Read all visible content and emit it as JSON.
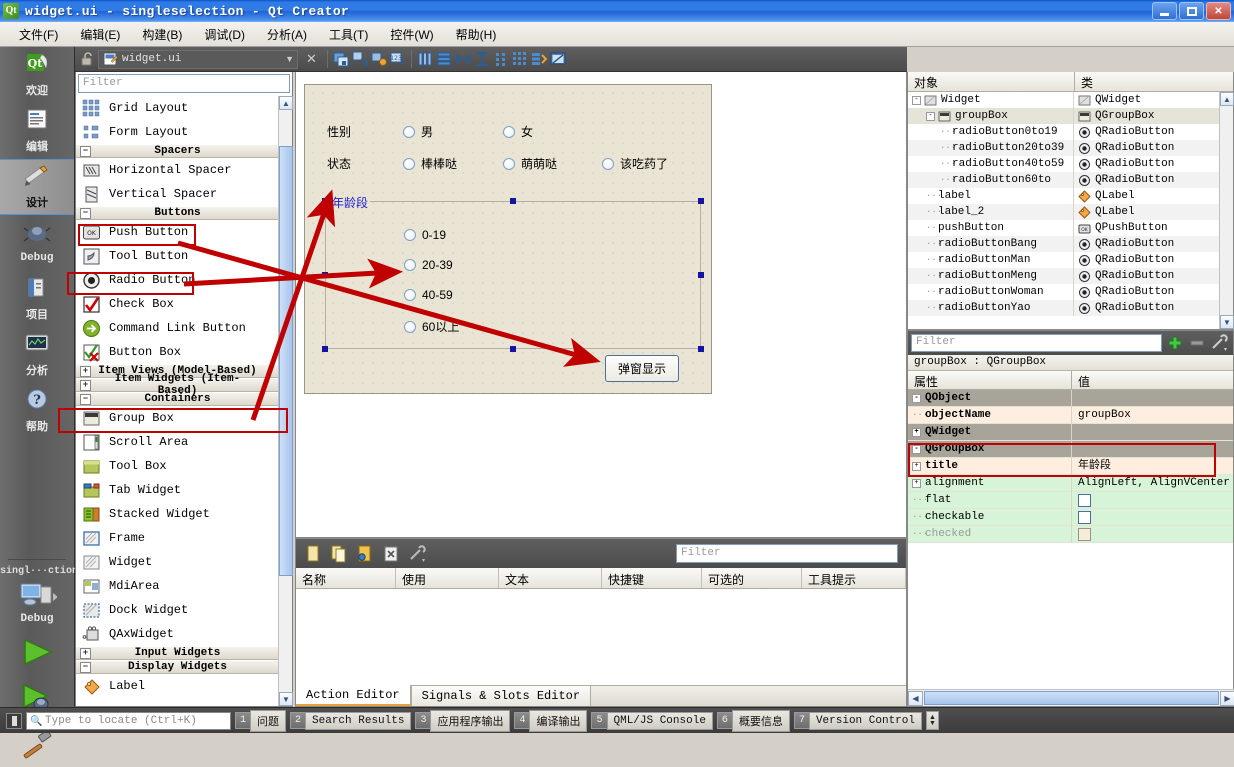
{
  "window": {
    "title": "widget.ui - singleselection - Qt Creator",
    "app_icon": "qt-logo-icon",
    "buttons": {
      "minimize": "minimize-icon",
      "maximize": "maximize-icon",
      "close": "close-icon"
    }
  },
  "menubar": {
    "items": [
      {
        "label": "文件(F)"
      },
      {
        "label": "编辑(E)"
      },
      {
        "label": "构建(B)"
      },
      {
        "label": "调试(D)"
      },
      {
        "label": "分析(A)"
      },
      {
        "label": "工具(T)"
      },
      {
        "label": "控件(W)"
      },
      {
        "label": "帮助(H)"
      }
    ]
  },
  "modebar": {
    "modes": [
      {
        "label": "欢迎",
        "icon": "qt-welcome-icon",
        "active": false
      },
      {
        "label": "编辑",
        "icon": "edit-document-icon",
        "active": false
      },
      {
        "label": "设计",
        "icon": "design-pencil-ruler-icon",
        "active": true
      },
      {
        "label": "Debug",
        "icon": "debug-bug-icon",
        "active": false
      },
      {
        "label": "项目",
        "icon": "projects-book-icon",
        "active": false
      },
      {
        "label": "分析",
        "icon": "analyze-monitor-icon",
        "active": false
      },
      {
        "label": "帮助",
        "icon": "help-question-icon",
        "active": false
      }
    ],
    "kit_name": "singl···ction",
    "kit_config": "Debug",
    "run_button": "run-play-icon",
    "debug_button": "run-debug-icon",
    "build_button": "build-hammer-icon"
  },
  "editor_toolbar": {
    "lock_icon": "unlock-icon",
    "file_icon": "ui-file-icon",
    "filename": "widget.ui",
    "dropdown_icon": "chevron-down-icon",
    "close_icon": "close-x-icon",
    "tools": [
      "adjust-size-icon",
      "break-layout-icon",
      "signal-slot-editor-icon",
      "buddy-editor-icon",
      "layout-vertical-icon",
      "layout-horizontal-icon",
      "layout-splitter-h-icon",
      "layout-splitter-v-icon",
      "layout-form-icon",
      "layout-grid-icon",
      "layout-morph-icon",
      "preview-icon"
    ]
  },
  "widget_box": {
    "filter_placeholder": "Filter",
    "sections": [
      {
        "type": "item",
        "label": "Grid Layout",
        "icon": "grid-layout-icon"
      },
      {
        "type": "item",
        "label": "Form Layout",
        "icon": "form-layout-icon"
      },
      {
        "type": "category",
        "label": "Spacers",
        "expanded": true
      },
      {
        "type": "item",
        "label": "Horizontal Spacer",
        "icon": "horizontal-spacer-icon"
      },
      {
        "type": "item",
        "label": "Vertical Spacer",
        "icon": "vertical-spacer-icon"
      },
      {
        "type": "category",
        "label": "Buttons",
        "expanded": true
      },
      {
        "type": "item",
        "label": "Push Button",
        "icon": "push-button-icon",
        "highlighted": true
      },
      {
        "type": "item",
        "label": "Tool Button",
        "icon": "tool-button-icon"
      },
      {
        "type": "item",
        "label": "Radio Button",
        "icon": "radio-button-icon",
        "highlighted": true
      },
      {
        "type": "item",
        "label": "Check Box",
        "icon": "check-box-icon"
      },
      {
        "type": "item",
        "label": "Command Link Button",
        "icon": "command-link-button-icon"
      },
      {
        "type": "item",
        "label": "Button Box",
        "icon": "button-box-icon"
      },
      {
        "type": "category",
        "label": "Item Views (Model-Based)",
        "expanded": false
      },
      {
        "type": "category",
        "label": "Item Widgets (Item-Based)",
        "expanded": false
      },
      {
        "type": "category",
        "label": "Containers",
        "expanded": true
      },
      {
        "type": "item",
        "label": "Group Box",
        "icon": "group-box-icon",
        "highlighted": true
      },
      {
        "type": "item",
        "label": "Scroll Area",
        "icon": "scroll-area-icon"
      },
      {
        "type": "item",
        "label": "Tool Box",
        "icon": "tool-box-icon"
      },
      {
        "type": "item",
        "label": "Tab Widget",
        "icon": "tab-widget-icon"
      },
      {
        "type": "item",
        "label": "Stacked Widget",
        "icon": "stacked-widget-icon"
      },
      {
        "type": "item",
        "label": "Frame",
        "icon": "frame-icon"
      },
      {
        "type": "item",
        "label": "Widget",
        "icon": "widget-icon"
      },
      {
        "type": "item",
        "label": "MdiArea",
        "icon": "mdi-area-icon"
      },
      {
        "type": "item",
        "label": "Dock Widget",
        "icon": "dock-widget-icon"
      },
      {
        "type": "item",
        "label": "QAxWidget",
        "icon": "qax-widget-icon"
      },
      {
        "type": "category",
        "label": "Input Widgets",
        "expanded": false
      },
      {
        "type": "category",
        "label": "Display Widgets",
        "expanded": true
      },
      {
        "type": "item",
        "label": "Label",
        "icon": "label-icon"
      }
    ]
  },
  "form": {
    "labels": [
      {
        "name": "label",
        "text": "性别"
      },
      {
        "name": "label_2",
        "text": "状态"
      }
    ],
    "radios_gender": [
      {
        "name": "radioButtonMan",
        "text": "男"
      },
      {
        "name": "radioButtonWoman",
        "text": "女"
      }
    ],
    "radios_status": [
      {
        "name": "radioButtonBang",
        "text": "棒棒哒"
      },
      {
        "name": "radioButtonMeng",
        "text": "萌萌哒"
      },
      {
        "name": "radioButtonYao",
        "text": "该吃药了"
      }
    ],
    "group_box": {
      "name": "groupBox",
      "title": "年龄段",
      "radios": [
        {
          "name": "radioButton0to19",
          "text": "0-19"
        },
        {
          "name": "radioButton20to39",
          "text": "20-39"
        },
        {
          "name": "radioButton40to59",
          "text": "40-59"
        },
        {
          "name": "radioButton60to",
          "text": "60以上"
        }
      ]
    },
    "push_button": {
      "name": "pushButton",
      "text": "弹窗显示"
    }
  },
  "object_inspector": {
    "columns": [
      "对象",
      "类"
    ],
    "rows": [
      {
        "name": "Widget",
        "class": "QWidget",
        "indent": 0,
        "expander": "-",
        "icon": "widget-tree-icon",
        "selected": false
      },
      {
        "name": "groupBox",
        "class": "QGroupBox",
        "indent": 1,
        "expander": "-",
        "icon": "groupbox-tree-icon",
        "selected": true
      },
      {
        "name": "radioButton0to19",
        "class": "QRadioButton",
        "indent": 2,
        "expander": "",
        "icon": "radio-tree-icon",
        "selected": false
      },
      {
        "name": "radioButton20to39",
        "class": "QRadioButton",
        "indent": 2,
        "expander": "",
        "icon": "radio-tree-icon",
        "selected": false
      },
      {
        "name": "radioButton40to59",
        "class": "QRadioButton",
        "indent": 2,
        "expander": "",
        "icon": "radio-tree-icon",
        "selected": false
      },
      {
        "name": "radioButton60to",
        "class": "QRadioButton",
        "indent": 2,
        "expander": "",
        "icon": "radio-tree-icon",
        "selected": false
      },
      {
        "name": "label",
        "class": "QLabel",
        "indent": 1,
        "expander": "",
        "icon": "label-tree-icon",
        "selected": false
      },
      {
        "name": "label_2",
        "class": "QLabel",
        "indent": 1,
        "expander": "",
        "icon": "label-tree-icon",
        "selected": false
      },
      {
        "name": "pushButton",
        "class": "QPushButton",
        "indent": 1,
        "expander": "",
        "icon": "pushbutton-tree-icon",
        "selected": false
      },
      {
        "name": "radioButtonBang",
        "class": "QRadioButton",
        "indent": 1,
        "expander": "",
        "icon": "radio-tree-icon",
        "selected": false
      },
      {
        "name": "radioButtonMan",
        "class": "QRadioButton",
        "indent": 1,
        "expander": "",
        "icon": "radio-tree-icon",
        "selected": false
      },
      {
        "name": "radioButtonMeng",
        "class": "QRadioButton",
        "indent": 1,
        "expander": "",
        "icon": "radio-tree-icon",
        "selected": false
      },
      {
        "name": "radioButtonWoman",
        "class": "QRadioButton",
        "indent": 1,
        "expander": "",
        "icon": "radio-tree-icon",
        "selected": false
      },
      {
        "name": "radioButtonYao",
        "class": "QRadioButton",
        "indent": 1,
        "expander": "",
        "icon": "radio-tree-icon",
        "selected": false
      }
    ]
  },
  "property_editor": {
    "filter_placeholder": "Filter",
    "add_icon": "plus-icon",
    "remove_icon": "minus-icon",
    "config_icon": "wrench-icon",
    "object_line": "groupBox : QGroupBox",
    "columns": [
      "属性",
      "值"
    ],
    "rows": [
      {
        "key": "QObject",
        "value": "",
        "kind": "group",
        "expander": "-"
      },
      {
        "key": "objectName",
        "value": "groupBox",
        "kind": "sub",
        "expander": ""
      },
      {
        "key": "QWidget",
        "value": "",
        "kind": "group",
        "expander": "+"
      },
      {
        "key": "QGroupBox",
        "value": "",
        "kind": "group",
        "expander": "-",
        "highlighted": true
      },
      {
        "key": "title",
        "value": "年龄段",
        "kind": "sub",
        "expander": "+",
        "highlighted": true
      },
      {
        "key": "alignment",
        "value": "AlignLeft, AlignVCenter",
        "kind": "green",
        "expander": "+"
      },
      {
        "key": "flat",
        "value": "",
        "kind": "green",
        "expander": "",
        "checkbox": "unchecked"
      },
      {
        "key": "checkable",
        "value": "",
        "kind": "green",
        "expander": "",
        "checkbox": "unchecked"
      },
      {
        "key": "checked",
        "value": "",
        "kind": "green",
        "expander": "",
        "checkbox": "disabled",
        "disabled": true
      }
    ],
    "hscroll": {
      "left_icon": "chevron-left-icon",
      "right_icon": "chevron-right-icon"
    }
  },
  "action_editor": {
    "toolbar_icons": [
      "new-action-icon",
      "copy-action-icon",
      "edit-action-icon",
      "delete-action-icon",
      "configure-icon"
    ],
    "filter_placeholder": "Filter",
    "columns": [
      "名称",
      "使用",
      "文本",
      "快捷键",
      "可选的",
      "工具提示"
    ],
    "rows": [],
    "tabs": [
      {
        "label": "Action Editor",
        "active": true
      },
      {
        "label": "Signals & Slots Editor",
        "active": false
      }
    ]
  },
  "statusbar": {
    "locate_placeholder": "Type to locate (Ctrl+K)",
    "search_icon": "magnifier-icon",
    "panel_toggle_icon": "panel-toggle-icon",
    "items": [
      {
        "num": "1",
        "label": "问题"
      },
      {
        "num": "2",
        "label": "Search Results"
      },
      {
        "num": "3",
        "label": "应用程序输出"
      },
      {
        "num": "4",
        "label": "编译输出"
      },
      {
        "num": "5",
        "label": "QML/JS Console"
      },
      {
        "num": "6",
        "label": "概要信息"
      },
      {
        "num": "7",
        "label": "Version Control"
      }
    ],
    "updown_icon": "up-down-arrows-icon"
  },
  "annotations": {
    "color": "#c00000",
    "arrows": [
      {
        "from": "Push Button",
        "to": "弹窗显示"
      },
      {
        "from": "Radio Button",
        "to": "40-59"
      },
      {
        "from": "Group Box",
        "to": "年龄段"
      }
    ]
  }
}
